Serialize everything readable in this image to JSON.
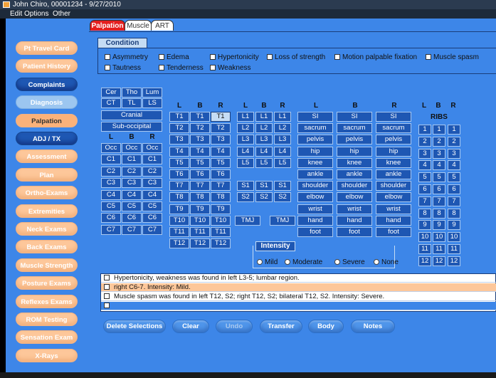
{
  "window": {
    "title": "John Chiro, 00001234 - 9/27/2010",
    "menu": [
      "Edit Options",
      "Other"
    ]
  },
  "sidebar": {
    "items": [
      "Pt Travel Card",
      "Patient History",
      "Complaints",
      "Diagnosis",
      "Palpation",
      "ADJ / TX",
      "Assessment",
      "Plan",
      "Ortho-Exams",
      "Extremities",
      "Neck Exams",
      "Back Exams",
      "Muscle Strength",
      "Posture Exams",
      "Reflexes Exams",
      "ROM Testing",
      "Sensation Exam",
      "X-Rays"
    ]
  },
  "tabs": [
    "Palpation",
    "Muscle",
    "ART"
  ],
  "condition": {
    "label": "Condition",
    "row1": [
      "Asymmetry",
      "Edema",
      "Hypertonicity",
      "Loss of strength",
      "Motion palpable fixation",
      "Muscle spasm"
    ],
    "row2": [
      "Tautness",
      "Tenderness",
      "Weakness"
    ]
  },
  "grid": {
    "top_row": [
      "Cer",
      "Tho",
      "Lum"
    ],
    "second_row": [
      "CT",
      "TL",
      "LS"
    ],
    "cranial": "Cranial",
    "suboccipital": "Sub-occipital",
    "lbr": [
      "L",
      "B",
      "R"
    ],
    "cervical": [
      [
        "Occ",
        "Occ",
        "Occ"
      ],
      [
        "C1",
        "C1",
        "C1"
      ],
      [
        "C2",
        "C2",
        "C2"
      ],
      [
        "C3",
        "C3",
        "C3"
      ],
      [
        "C4",
        "C4",
        "C4"
      ],
      [
        "C5",
        "C5",
        "C5"
      ],
      [
        "C6",
        "C6",
        "C6"
      ],
      [
        "C7",
        "C7",
        "C7"
      ]
    ],
    "thoracic": [
      [
        "T1",
        "T1",
        "T1"
      ],
      [
        "T2",
        "T2",
        "T2"
      ],
      [
        "T3",
        "T3",
        "T3"
      ],
      [
        "T4",
        "T4",
        "T4"
      ],
      [
        "T5",
        "T5",
        "T5"
      ],
      [
        "T6",
        "T6",
        "T6"
      ],
      [
        "T7",
        "T7",
        "T7"
      ],
      [
        "T8",
        "T8",
        "T8"
      ],
      [
        "T9",
        "T9",
        "T9"
      ],
      [
        "T10",
        "T10",
        "T10"
      ],
      [
        "T11",
        "T11",
        "T11"
      ],
      [
        "T12",
        "T12",
        "T12"
      ]
    ],
    "lumbar": [
      [
        "L1",
        "L1",
        "L1"
      ],
      [
        "L2",
        "L2",
        "L2"
      ],
      [
        "L3",
        "L3",
        "L3"
      ],
      [
        "L4",
        "L4",
        "L4"
      ],
      [
        "L5",
        "L5",
        "L5"
      ]
    ],
    "sacral": [
      [
        "S1",
        "S1",
        "S1"
      ],
      [
        "S2",
        "S2",
        "S2"
      ]
    ],
    "tmj": [
      "TMJ",
      "TMJ"
    ],
    "extremities": [
      "SI",
      "sacrum",
      "pelvis",
      "hip",
      "knee",
      "ankle",
      "shoulder",
      "elbow",
      "wrist",
      "hand",
      "foot"
    ],
    "ribs_label": "RIBS",
    "ribs": [
      "1",
      "2",
      "3",
      "4",
      "5",
      "6",
      "7",
      "8",
      "9",
      "10",
      "11",
      "12"
    ]
  },
  "intensity": {
    "label": "Intensity",
    "options": [
      "Mild",
      "Moderate",
      "Severe",
      "None"
    ]
  },
  "findings": [
    "Hypertonicity, weakness was found in left L3-5; lumbar region.",
    "right C6-7. Intensity: Mild.",
    "Muscle spasm was found in left T12, S2; right T12, S2; bilateral T12, S2. Intensity: Severe.",
    ""
  ],
  "actions": [
    "Delete Selections",
    "Clear",
    "Undo",
    "Transfer",
    "Body",
    "Notes"
  ],
  "colors": {
    "accent": "#3d86e8",
    "dark_button": "#1e57b3",
    "light_button": "#c5dcf4",
    "orange": "#fdc79a",
    "active_tab": "#e41e1e"
  }
}
